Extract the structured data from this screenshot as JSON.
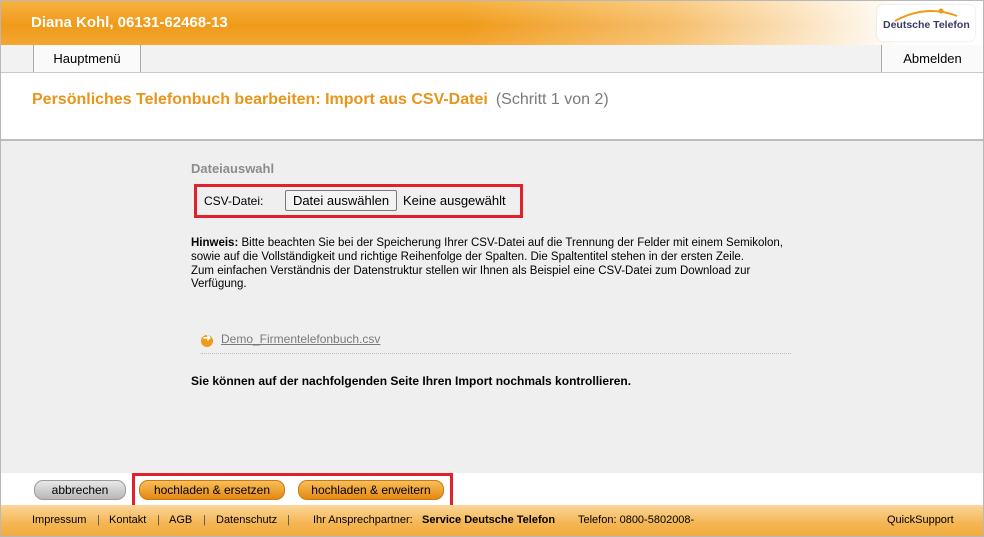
{
  "header": {
    "user": "Diana Kohl, 06131-62468-13",
    "logo_text": "Deutsche Telefon"
  },
  "nav": {
    "main_menu": "Hauptmenü",
    "logout": "Abmelden"
  },
  "title": {
    "main": "Persönliches Telefonbuch bearbeiten: Import aus CSV-Datei",
    "step": "(Schritt 1 von 2)"
  },
  "file_section": {
    "title": "Dateiauswahl",
    "label": "CSV-Datei:",
    "choose_button": "Datei auswählen",
    "no_file": "Keine ausgewählt"
  },
  "hint": {
    "label": "Hinweis:",
    "text1": " Bitte beachten Sie bei der Speicherung Ihrer CSV-Datei auf die Trennung der Felder mit einem Semikolon, sowie auf die Vollständigkeit und richtige Reihenfolge der Spalten. Die Spaltentitel stehen in der ersten Zeile.",
    "text2": "Zum einfachen Verständnis der Datenstruktur stellen wir Ihnen als Beispiel eine CSV-Datei zum Download zur Verfügung."
  },
  "demo_link": "Demo_Firmentelefonbuch.csv",
  "note": "Sie können auf der nachfolgenden Seite Ihren Import nochmals kontrollieren.",
  "buttons": {
    "cancel": "abbrechen",
    "upload_replace": "hochladen & ersetzen",
    "upload_extend": "hochladen & erweitern"
  },
  "footer": {
    "impressum": "Impressum",
    "kontakt": "Kontakt",
    "agb": "AGB",
    "datenschutz": "Datenschutz",
    "contact_label": "Ihr Ansprechpartner:",
    "contact_name": "Service Deutsche Telefon",
    "phone": "Telefon: 0800-5802008-",
    "support": "QuickSupport",
    "separator": "|"
  },
  "colors": {
    "accent": "#f09a1a",
    "title": "#e8951a",
    "highlight": "#e0202a"
  }
}
